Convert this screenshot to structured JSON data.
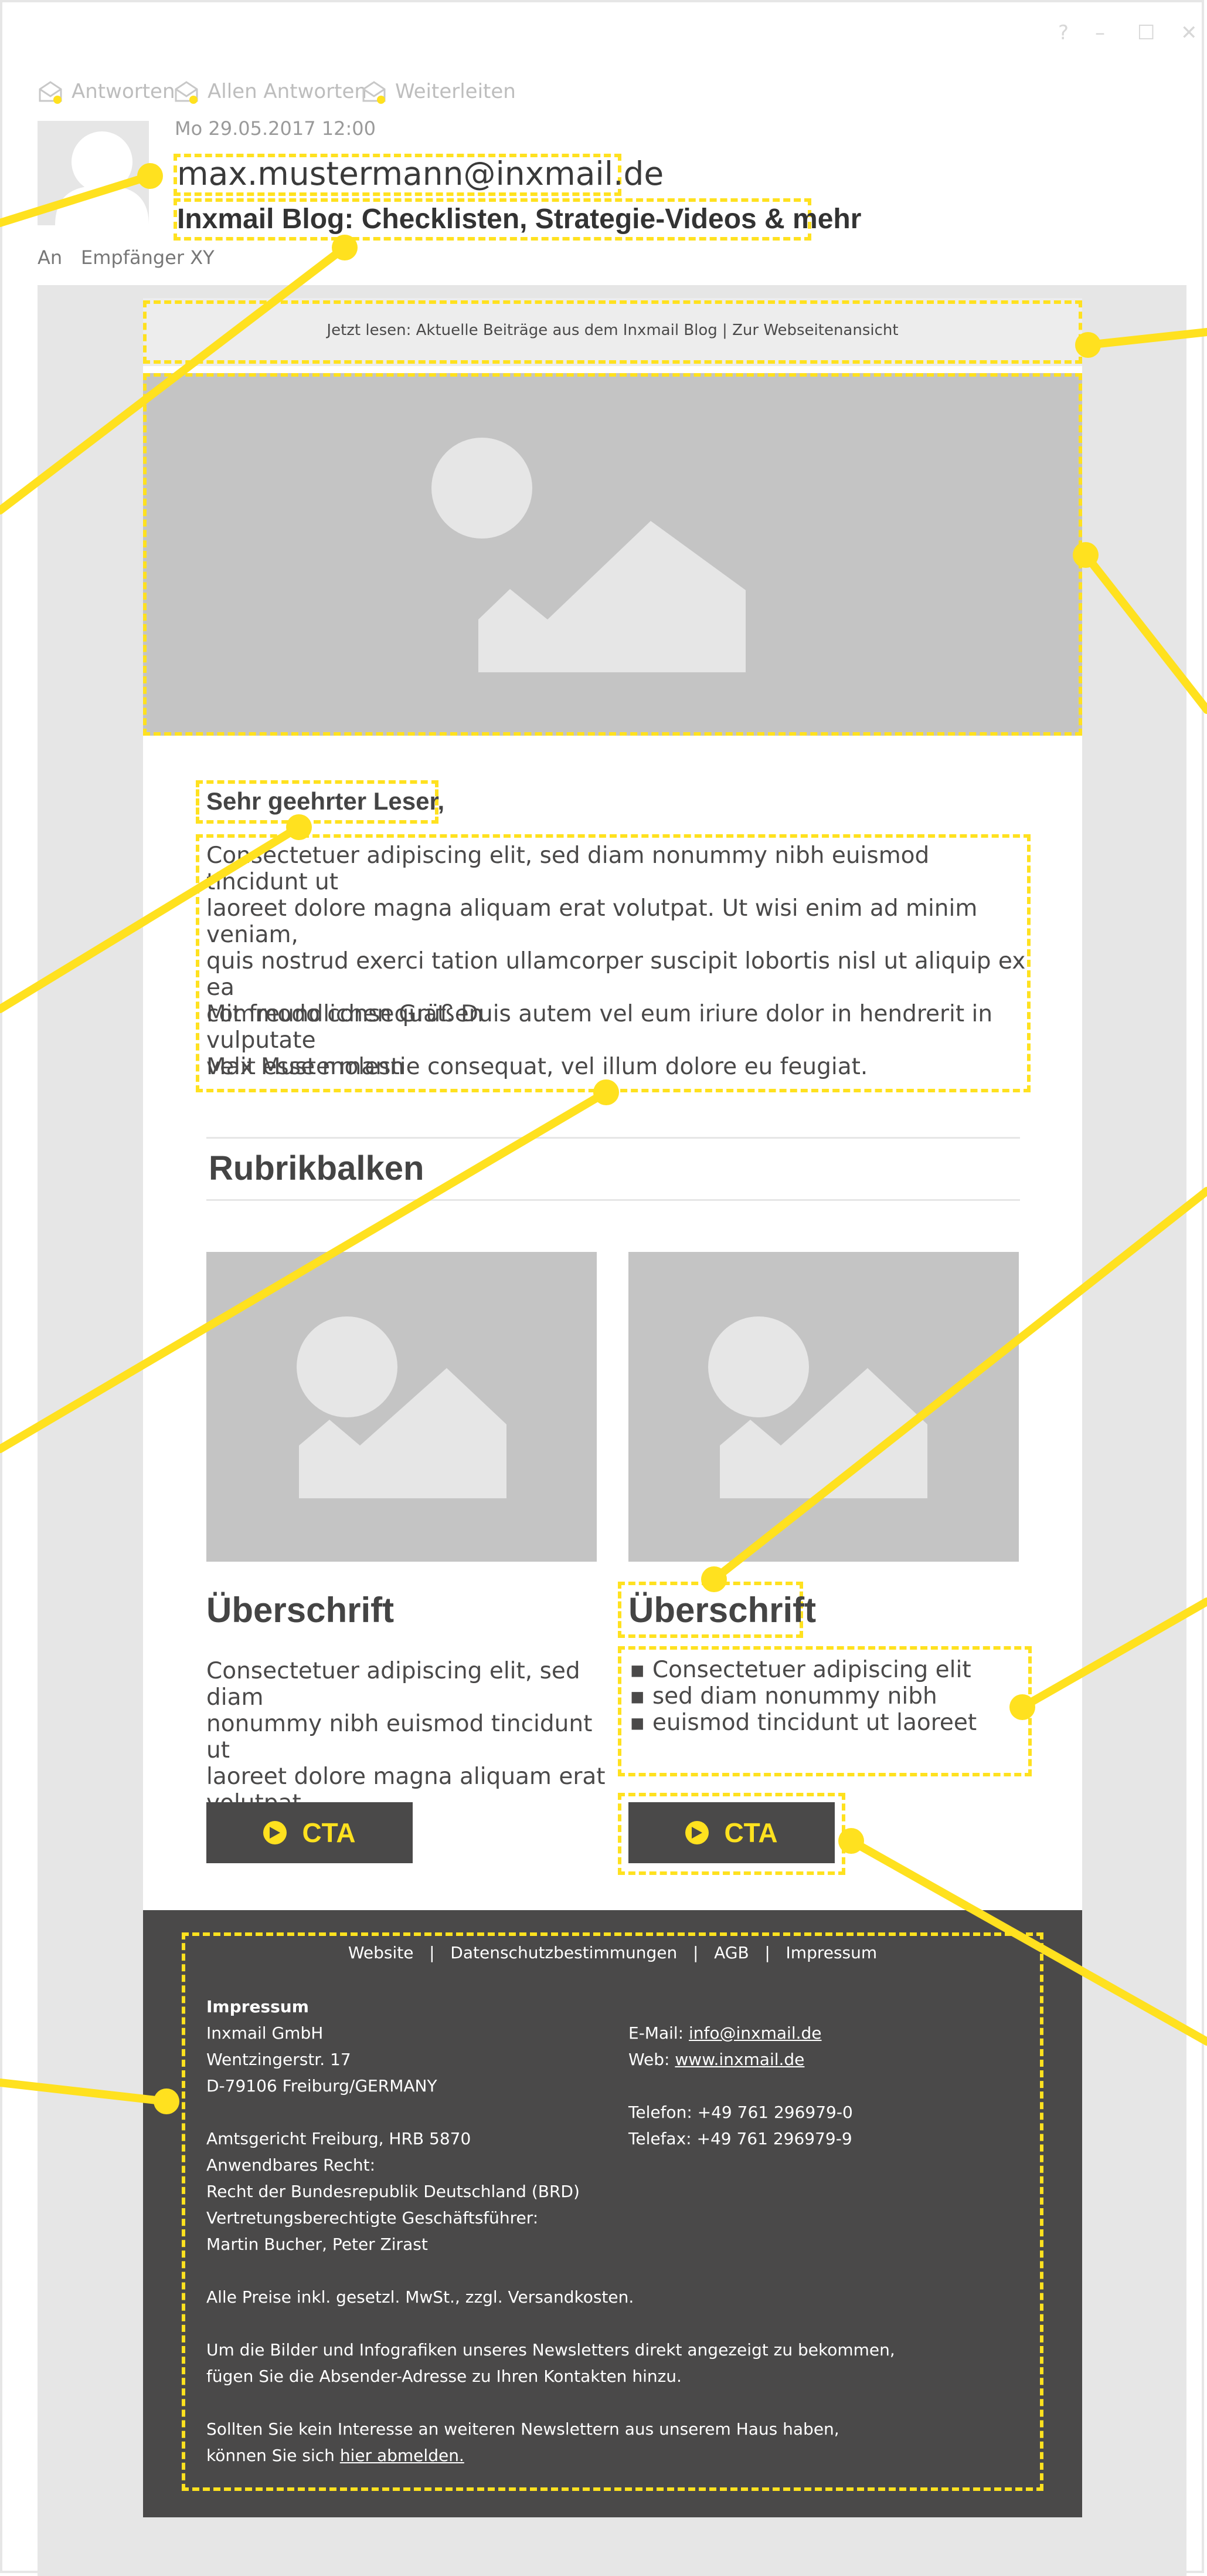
{
  "window": {
    "controls": [
      "?",
      "–",
      "☐",
      "✕"
    ]
  },
  "toolbar": {
    "actions": [
      {
        "label": "Antworten",
        "icon": "envelope-reply-icon"
      },
      {
        "label": "Allen Antworten",
        "icon": "envelope-reply-all-icon"
      },
      {
        "label": "Weiterleiten",
        "icon": "envelope-forward-icon"
      }
    ]
  },
  "message": {
    "date": "Mo 29.05.2017 12:00",
    "sender": "max.mustermann@inxmail.de",
    "subject": "Inxmail Blog: Checklisten, Strategie-Videos & mehr",
    "to_label": "An",
    "to_value": "Empfänger XY"
  },
  "newsletter": {
    "preheader": "Jetzt lesen: Aktuelle Beiträge aus dem Inxmail Blog | Zur Webseitenansicht",
    "salutation": "Sehr geehrter Leser,",
    "intro_lines": [
      "Consectetuer adipiscing elit, sed diam nonummy nibh euismod tincidunt ut",
      "laoreet dolore magna aliquam erat volutpat. Ut wisi enim ad minim veniam,",
      "quis nostrud exerci tation ullamcorper suscipit lobortis nisl ut aliquip ex ea",
      "commodo consequat. Duis autem vel eum iriure dolor in hendrerit in vulputate",
      "velit esse molestie consequat, vel illum dolore eu feugiat."
    ],
    "closing": "Mit freundlichen Grüßen",
    "signature": "Max Mustermann",
    "section_title": "Rubrikbalken",
    "left_column": {
      "heading": "Überschrift",
      "text_lines": [
        "Consectetuer adipiscing elit, sed diam",
        "nonummy nibh euismod tincidunt ut",
        "laoreet dolore magna aliquam erat",
        "volutpat."
      ],
      "cta": "CTA"
    },
    "right_column": {
      "heading": "Überschrift",
      "bullets": [
        "Consectetuer adipiscing elit",
        "sed diam nonummy nibh",
        "euismod tincidunt ut laoreet"
      ],
      "cta": "CTA"
    },
    "footer": {
      "links": [
        "Website",
        "Datenschutzbestimmungen",
        "AGB",
        "Impressum"
      ],
      "separator": "|",
      "impressum_title": "Impressum",
      "address": [
        "Inxmail GmbH",
        "Wentzingerstr. 17",
        "D-79106 Freiburg/GERMANY"
      ],
      "legal": [
        "Amtsgericht Freiburg, HRB 5870",
        "Anwendbares Recht:",
        "Recht der Bundesrepublik Deutschland (BRD)",
        "Vertretungsberechtigte Geschäftsführer:",
        "Martin Bucher, Peter Zirast"
      ],
      "email_label": "E-Mail: ",
      "email": "info@inxmail.de",
      "web_label": "Web: ",
      "web": "www.inxmail.de",
      "phone": "Telefon: +49 761 296979-0",
      "fax": "Telefax: +49 761 296979-9",
      "prices": "Alle Preise inkl. gesetzl. MwSt., zzgl. Versandkosten.",
      "images_note": [
        "Um die Bilder und Infografiken unseres Newsletters direkt angezeigt zu bekommen,",
        "fügen Sie die Absender-Adresse zu Ihren Kontakten hinzu."
      ],
      "unsubscribe_line1": "Sollten Sie kein Interesse an weiteren Newslettern aus unserem Haus haben,",
      "unsubscribe_prefix": "können Sie sich ",
      "unsubscribe_link": "hier abmelden."
    }
  },
  "colors": {
    "highlight": "#ffe11f",
    "text": "#4a4949",
    "placeholder": "#c4c4c4",
    "footer_bg": "#4a4949",
    "outer_bg": "#e6e6e6"
  }
}
